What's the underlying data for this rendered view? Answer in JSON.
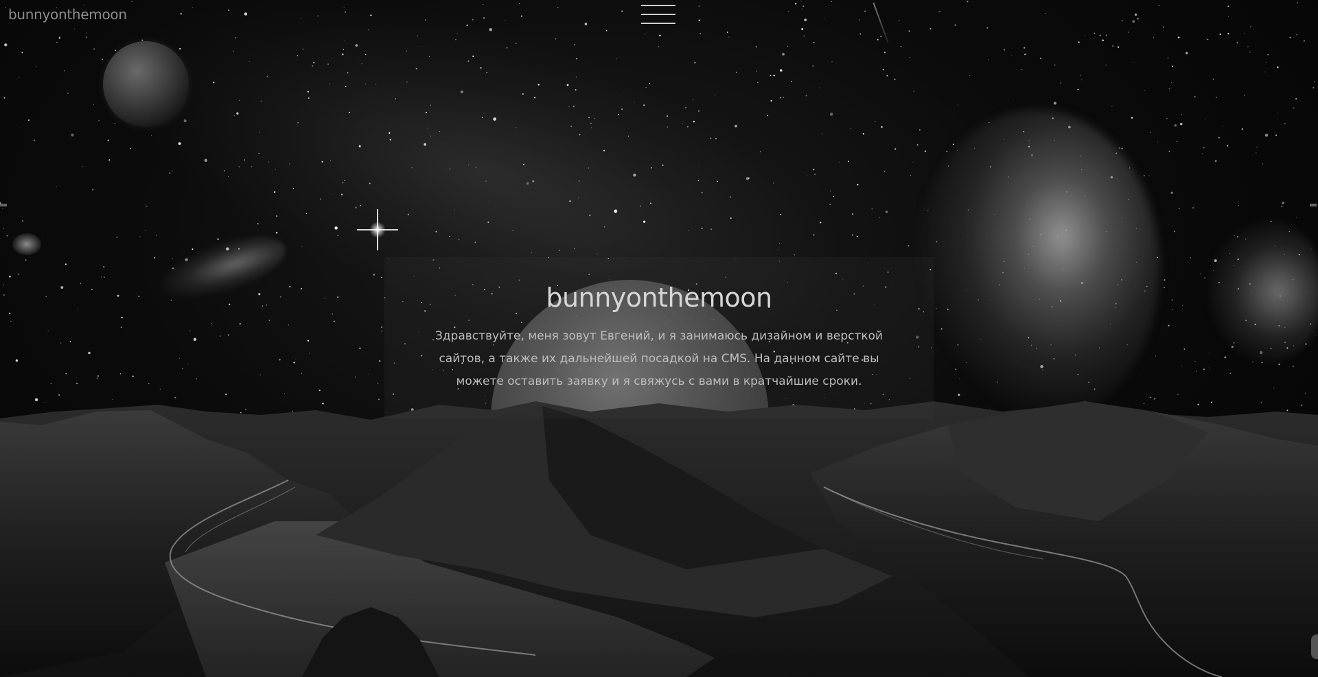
{
  "site": {
    "logo": "bunnyonthemoon"
  },
  "nav": {
    "menu_icon": "hamburger-menu-icon"
  },
  "hero": {
    "title": "bunnyonthemoon",
    "text": "Здравствуйте, меня зовут Евгений, и я занимаюсь дизайном и версткой сайтов, а также их дальнейшей посадкой на CMS. На данном сайте вы можете оставить заявку и я свяжусь с вами в кратчайшие сроки."
  },
  "colors": {
    "background": "#050505",
    "text_primary": "#d6d6d6",
    "text_secondary": "#bdbdbd",
    "logo": "#8d8d8d"
  }
}
